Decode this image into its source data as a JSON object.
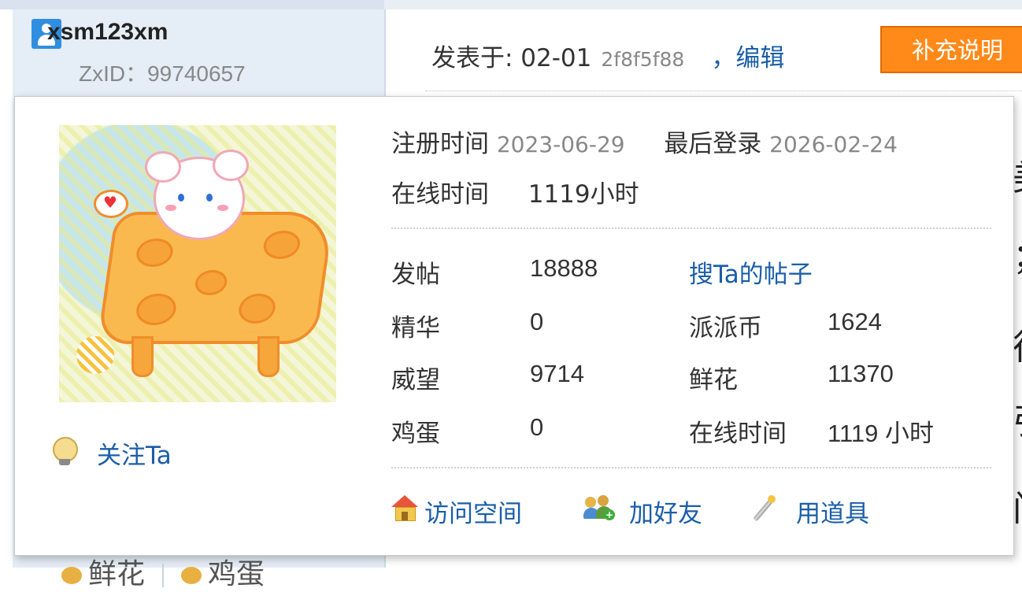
{
  "post": {
    "username": "xsm123xm",
    "zxid": "ZxID：99740657",
    "posted_label": "发表于: 02-01",
    "hash": "2f8f5f88",
    "edit_link": "，编辑",
    "supplement_button": "补充说明"
  },
  "background": {
    "right_chars": [
      "美",
      "；",
      "往",
      "引",
      "门"
    ],
    "bottom_items": [
      "鲜花",
      "鸡蛋"
    ]
  },
  "card": {
    "register_label": "注册时间",
    "register_value": "2023-06-29",
    "last_login_label": "最后登录",
    "last_login_value": "2026-02-24",
    "online_label": "在线时间",
    "online_value": "1119小时",
    "stats": {
      "posts_label": "发帖",
      "posts_value": "18888",
      "search_link": "搜Ta的帖子",
      "digest_label": "精华",
      "digest_value": "0",
      "coins_label": "派派币",
      "coins_value": "1624",
      "prestige_label": "威望",
      "prestige_value": "9714",
      "flowers_label": "鲜花",
      "flowers_value": "11370",
      "eggs_label": "鸡蛋",
      "eggs_value": "0",
      "online2_label": "在线时间",
      "online2_value": "1119 小时"
    },
    "follow_link": "关注Ta",
    "actions": {
      "visit_space": "访问空间",
      "add_friend": "加好友",
      "use_item": "用道具"
    }
  },
  "colors": {
    "link": "#1a5ea8",
    "button": "#ff8a1a",
    "user_column": "#e5edf6"
  }
}
